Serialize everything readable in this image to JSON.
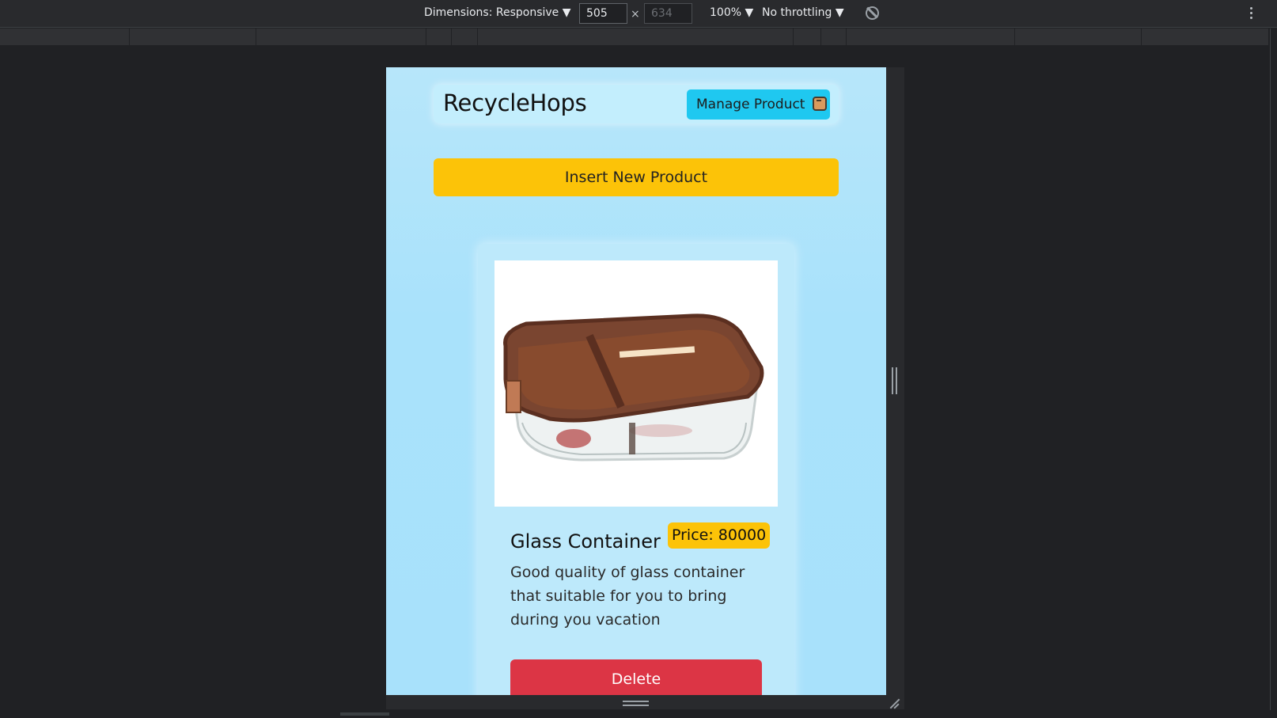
{
  "devtools": {
    "dimensions_label": "Dimensions: Responsive ▼",
    "width_value": "505",
    "height_value": "634",
    "times_sign": "×",
    "zoom_label": "100% ▼",
    "throttling_label": "No throttling ▼"
  },
  "page": {
    "brand": "RecycleHops",
    "manage_button": "Manage Product",
    "insert_button": "Insert New Product",
    "product": {
      "title": "Glass Container",
      "price": "Price: 80000",
      "description": "Good quality of glass container that suitable for you to bring during you vacation",
      "delete_button": "Delete"
    }
  },
  "colors": {
    "accent_yellow": "#fcc308",
    "accent_cyan": "#1fc8f0",
    "danger_red": "#dc3545",
    "page_bg": "#a9e2fb"
  },
  "icons": [
    "rotate-icon",
    "kebab-menu-icon",
    "box-icon"
  ]
}
